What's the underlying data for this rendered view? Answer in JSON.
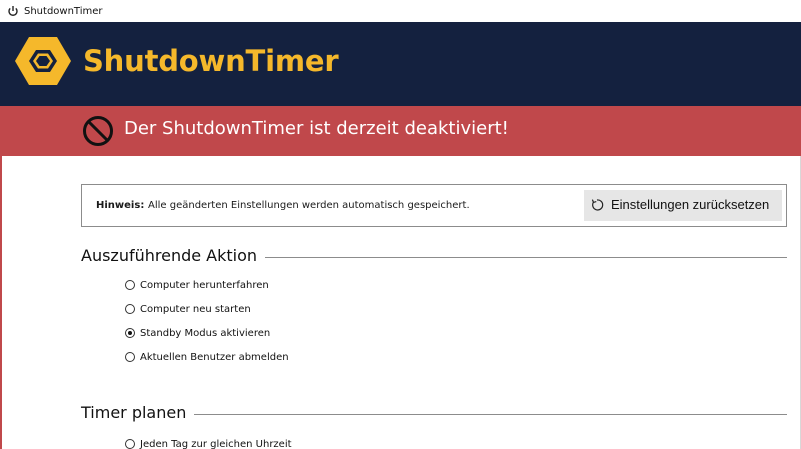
{
  "window": {
    "title": "ShutdownTimer",
    "icon": "power-icon"
  },
  "header": {
    "brand": "ShutdownTimer",
    "logo_icon": "hexagon-logo-icon",
    "brand_color": "#f5b82b",
    "background": "#14213f"
  },
  "status_bar": {
    "text": "Der ShutdownTimer ist derzeit deaktiviert!",
    "icon": "stop-icon",
    "background": "#c0484b"
  },
  "hint": {
    "label": "Hinweis:",
    "text": "Alle geänderten Einstellungen werden automatisch gespeichert.",
    "reset_button": {
      "label": "Einstellungen zurücksetzen",
      "icon": "reset-icon"
    }
  },
  "action_section": {
    "title": "Auszuführende Aktion",
    "options": [
      {
        "label": "Computer herunterfahren",
        "checked": false
      },
      {
        "label": "Computer neu starten",
        "checked": false
      },
      {
        "label": "Standby Modus aktivieren",
        "checked": true
      },
      {
        "label": "Aktuellen Benutzer abmelden",
        "checked": false
      }
    ]
  },
  "timer_section": {
    "title": "Timer planen",
    "options": [
      {
        "label": "Jeden Tag zur gleichen Uhrzeit",
        "checked": false
      }
    ]
  }
}
